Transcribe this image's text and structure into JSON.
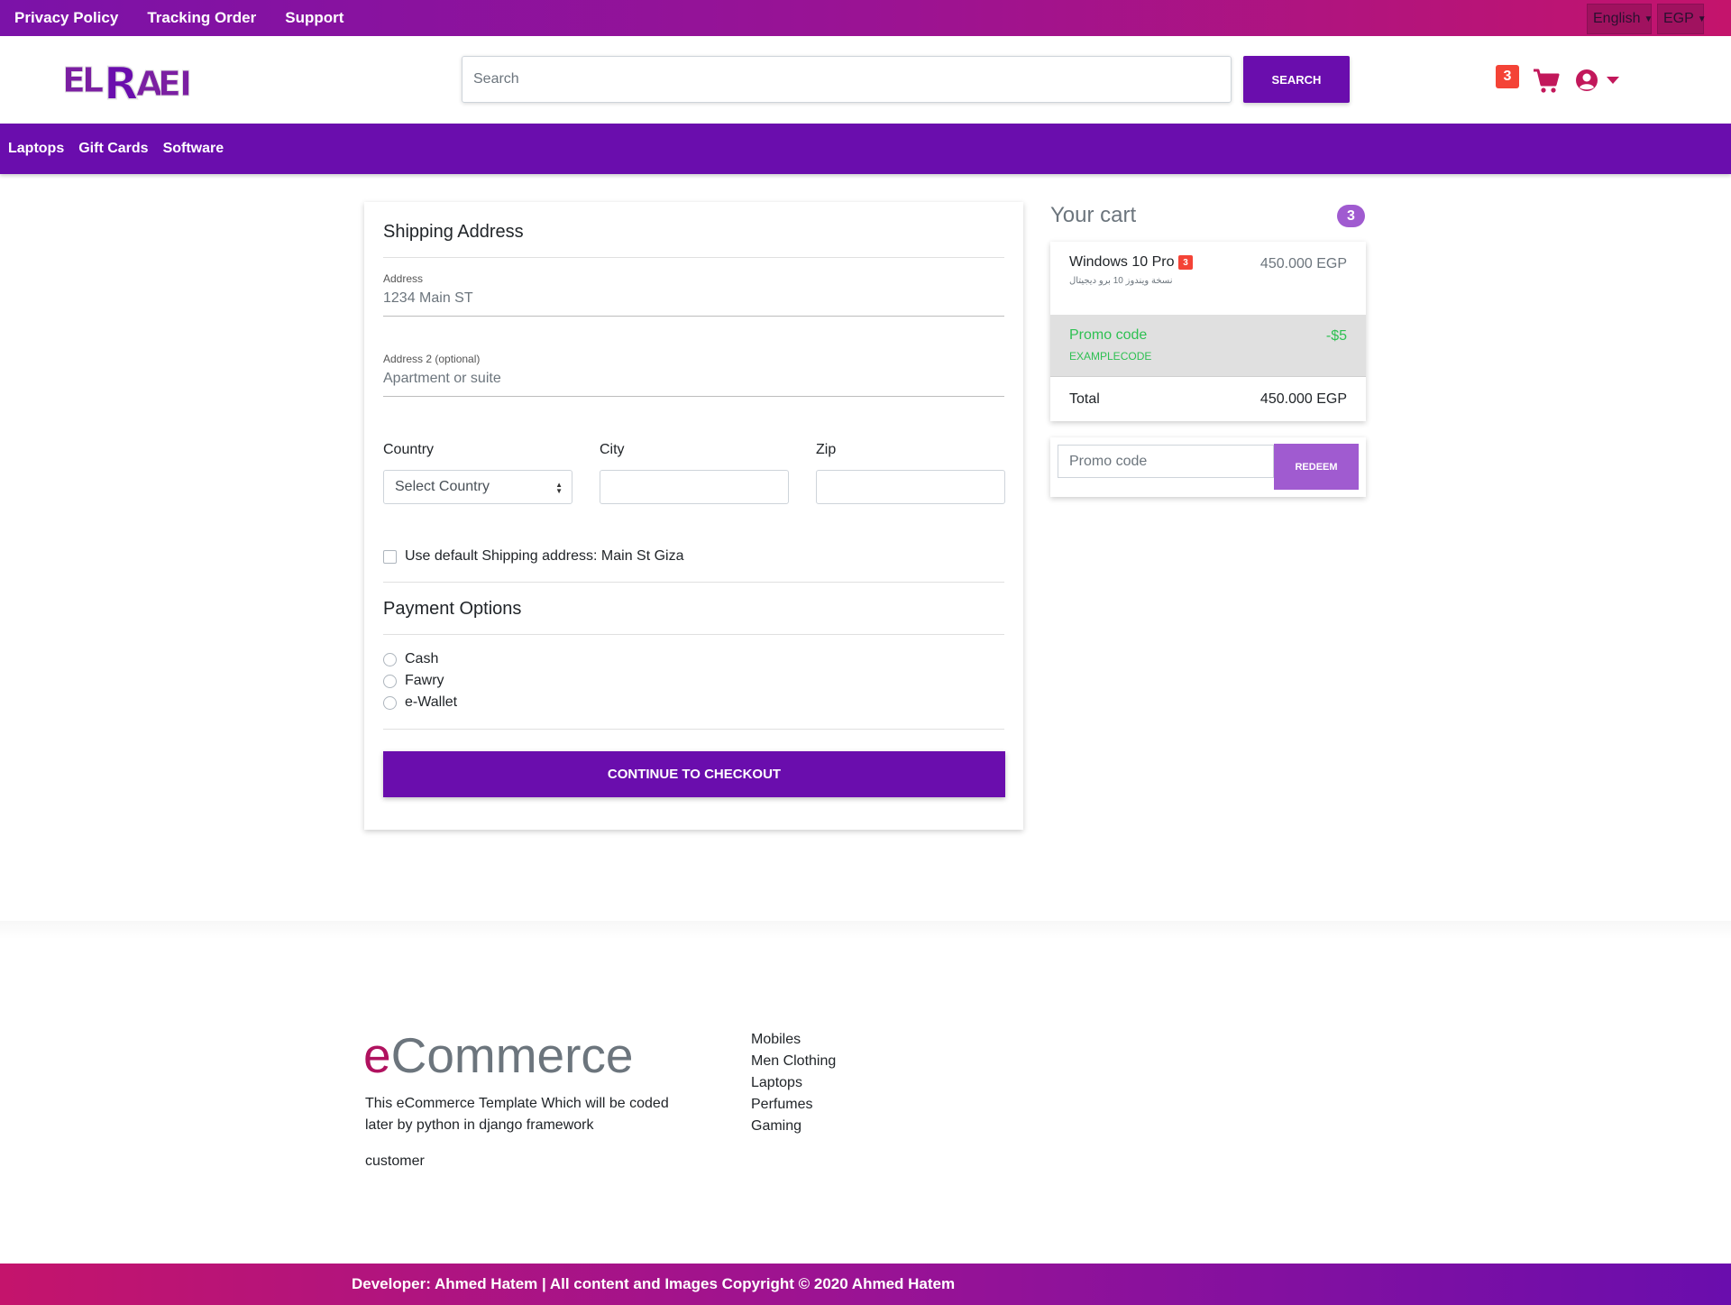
{
  "topbar": {
    "links": [
      "Privacy Policy",
      "Tracking Order",
      "Support"
    ],
    "language": "English",
    "currency": "EGP"
  },
  "header": {
    "logo_text": "ELRAEI",
    "search_placeholder": "Search",
    "search_button": "SEARCH",
    "cart_count": "3"
  },
  "nav": {
    "items": [
      "Laptops",
      "Gift Cards",
      "Software"
    ]
  },
  "shipping": {
    "title": "Shipping Address",
    "address_label": "Address",
    "address_value": "1234 Main ST",
    "address2_label": "Address 2 (optional)",
    "address2_placeholder": "Apartment or suite",
    "country_label": "Country",
    "country_value": "Select Country",
    "city_label": "City",
    "zip_label": "Zip",
    "default_address": "Use default Shipping address: Main St Giza"
  },
  "payment": {
    "title": "Payment Options",
    "options": [
      "Cash",
      "Fawry",
      "e-Wallet"
    ],
    "checkout_button": "CONTINUE TO CHECKOUT"
  },
  "cart": {
    "title": "Your cart",
    "count": "3",
    "item": {
      "name": "Windows 10 Pro",
      "qty": "3",
      "subtitle": "نسخة ويندوز 10 برو ديجيتال",
      "price": "450.000 EGP"
    },
    "promo": {
      "label": "Promo code",
      "code": "EXAMPLECODE",
      "amount": "-$5"
    },
    "total_label": "Total",
    "total_value": "450.000 EGP",
    "promo_placeholder": "Promo code",
    "redeem_button": "REDEEM"
  },
  "footer": {
    "brand_e": "e",
    "brand_rest": "Commerce",
    "description": "This eCommerce Template Which will be coded later by python in django framework",
    "customer": "customer",
    "links": [
      "Mobiles",
      "Men Clothing",
      "Laptops",
      "Perfumes",
      "Gaming"
    ],
    "copyright": "Developer: Ahmed Hatem | All content and Images Copyright © 2020 Ahmed Hatem"
  },
  "colors": {
    "primary": "#6a0dad",
    "accent": "#c4146c",
    "promo_green": "#2ec052",
    "badge_red": "#f44336"
  }
}
